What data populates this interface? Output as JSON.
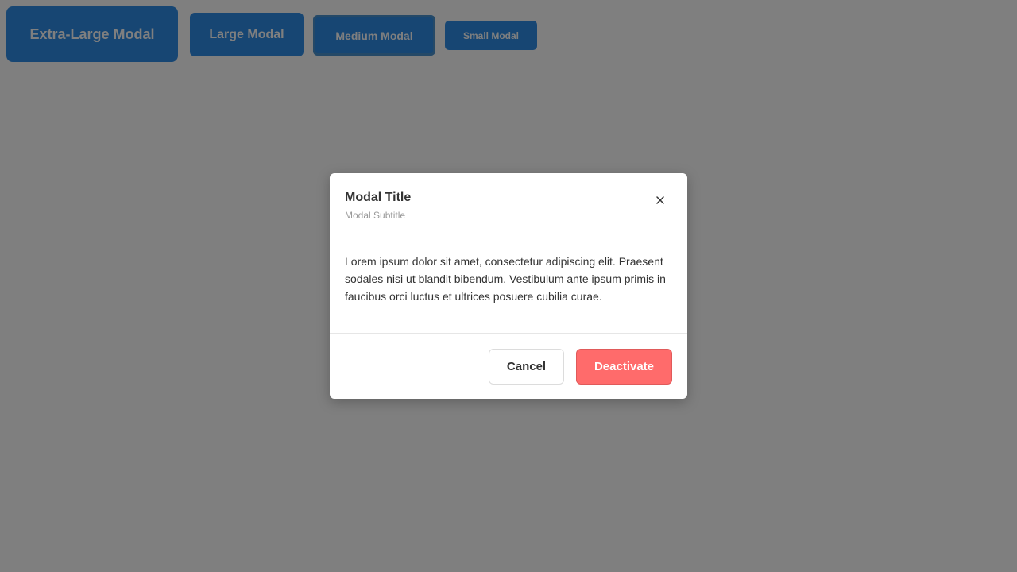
{
  "colors": {
    "launcher_blue": "#2e8ce6",
    "danger": "#ff6b6b",
    "overlay": "rgba(0,0,0,0.5)"
  },
  "launchers": {
    "extra_large": "Extra-Large Modal",
    "large": "Large Modal",
    "medium": "Medium Modal",
    "small": "Small Modal"
  },
  "modal": {
    "title": "Modal Title",
    "subtitle": "Modal Subtitle",
    "close_icon": "close-icon",
    "body": "Lorem ipsum dolor sit amet, consectetur adipiscing elit. Praesent sodales nisi ut blandit bibendum. Vestibulum ante ipsum primis in faucibus orci luctus et ultrices posuere cubilia curae.",
    "cancel_label": "Cancel",
    "confirm_label": "Deactivate"
  }
}
